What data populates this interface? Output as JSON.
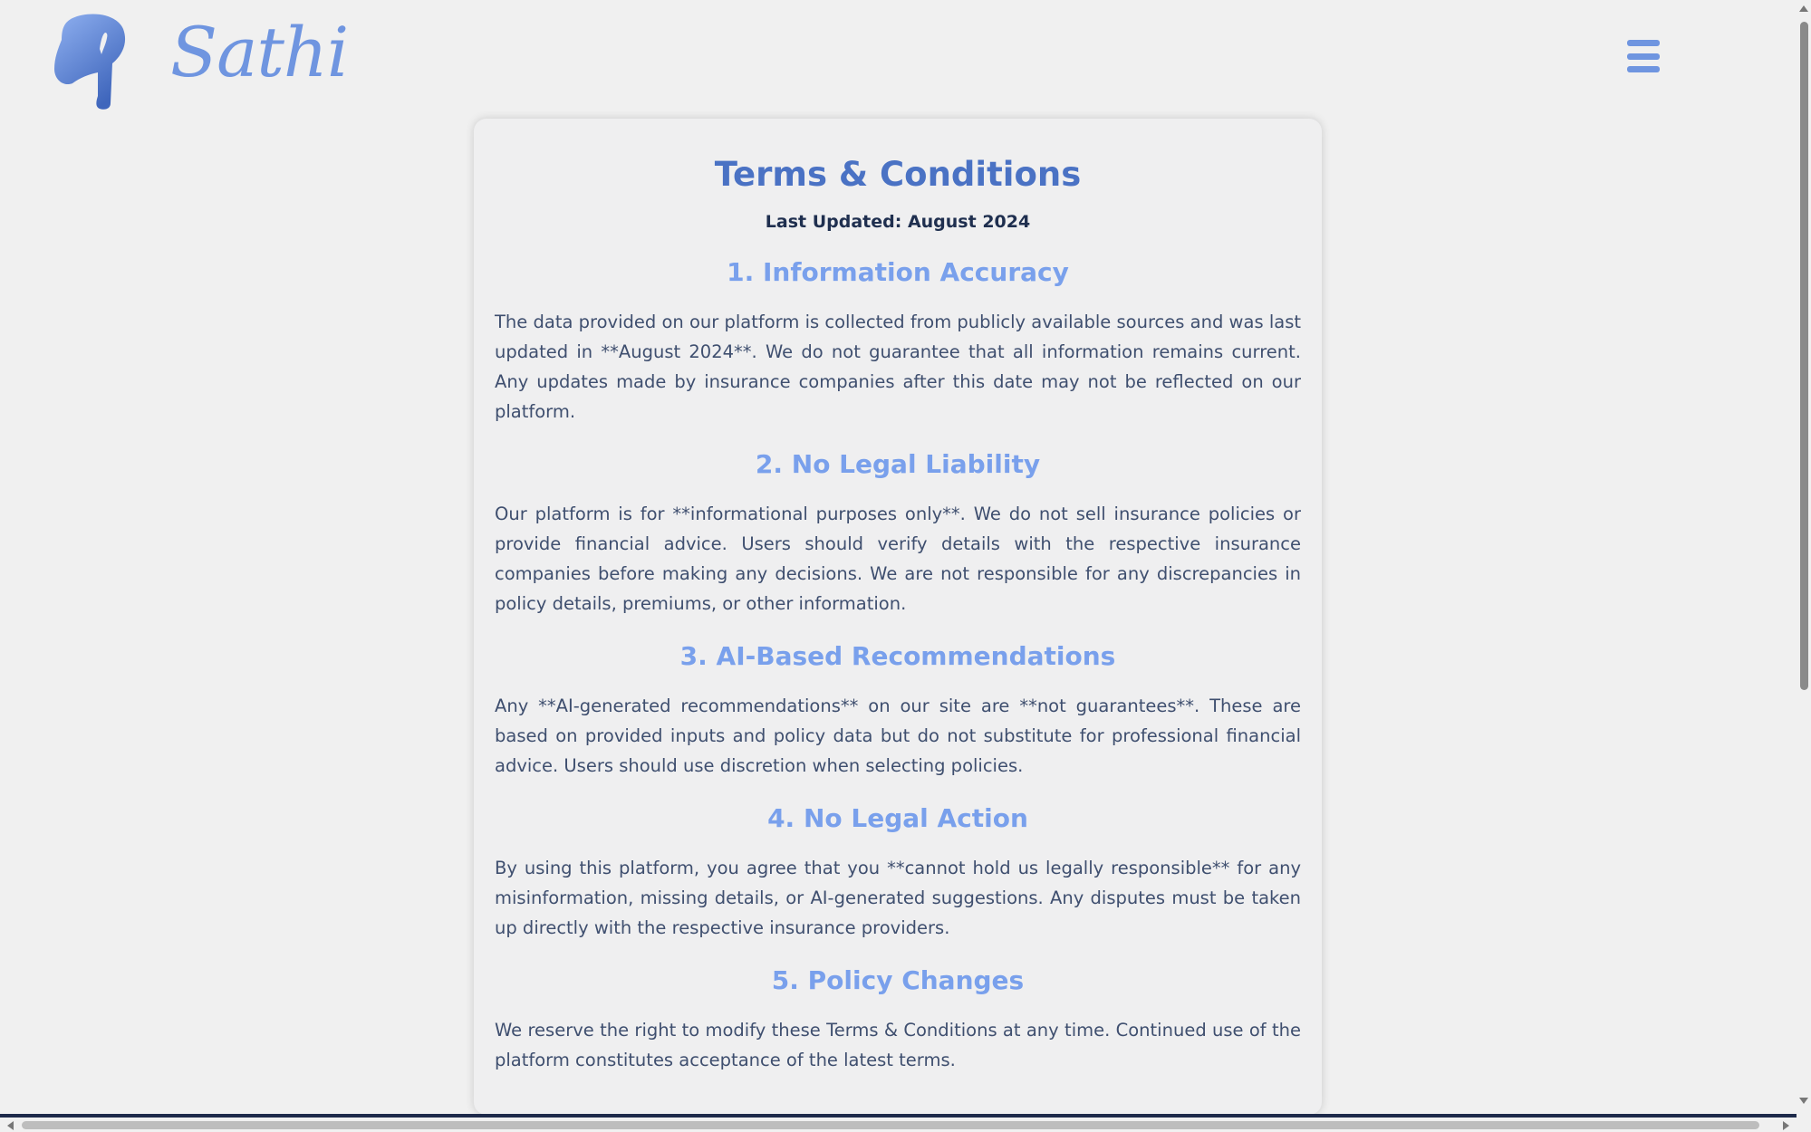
{
  "header": {
    "logo_text": "Sathi",
    "logo_icon": "elephant-head-icon",
    "menu_icon": "hamburger-menu-icon"
  },
  "terms": {
    "title": "Terms & Conditions",
    "last_updated": "Last Updated: August 2024",
    "sections": [
      {
        "heading": "1. Information Accuracy",
        "body": "The data provided on our platform is collected from publicly available sources and was last updated in **August 2024**. We do not guarantee that all information remains current. Any updates made by insurance companies after this date may not be reflected on our platform."
      },
      {
        "heading": "2. No Legal Liability",
        "body": "Our platform is for **informational purposes only**. We do not sell insurance policies or provide financial advice. Users should verify details with the respective insurance companies before making any decisions. We are not responsible for any discrepancies in policy details, premiums, or other information."
      },
      {
        "heading": "3. AI-Based Recommendations",
        "body": "Any **AI-generated recommendations** on our site are **not guarantees**. These are based on provided inputs and policy data but do not substitute for professional financial advice. Users should use discretion when selecting policies."
      },
      {
        "heading": "4. No Legal Action",
        "body": "By using this platform, you agree that you **cannot hold us legally responsible** for any misinformation, missing details, or AI-generated suggestions. Any disputes must be taken up directly with the respective insurance providers."
      },
      {
        "heading": "5. Policy Changes",
        "body": "We reserve the right to modify these Terms & Conditions at any time. Continued use of the platform constitutes acceptance of the latest terms."
      }
    ]
  },
  "colors": {
    "brand": "#6f95e0",
    "title": "#4a72c4",
    "heading": "#79a0ec",
    "body_text": "#3f4f6f",
    "background": "#f0f0f0"
  }
}
